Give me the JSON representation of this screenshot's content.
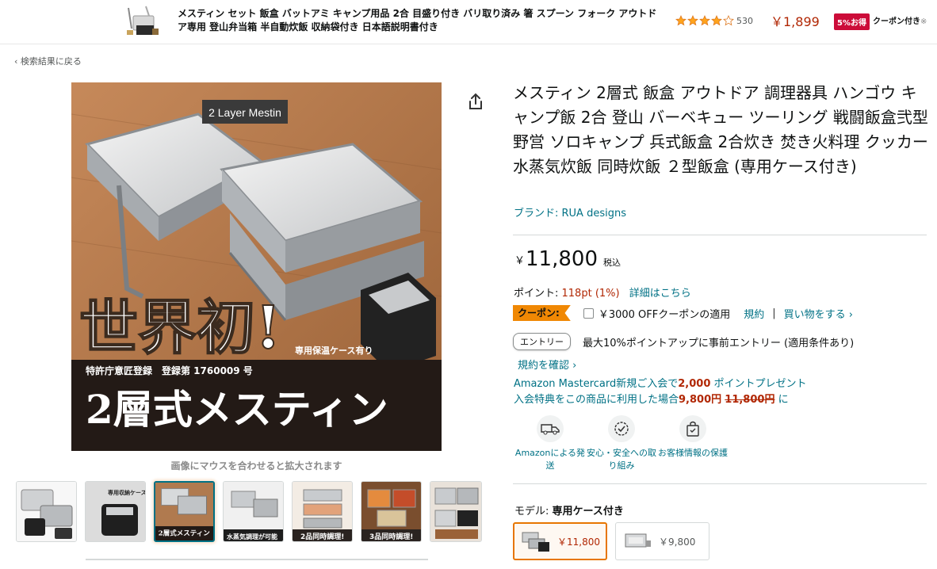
{
  "ad": {
    "title": "メスティン セット 飯盒 バットアミ キャンプ用品 2合 目盛り付き バリ取り済み 箸 スプーン フォーク アウトドア専用 登山弁当箱 半自動炊飯 収納袋付き 日本語説明書付き",
    "rating": 4.0,
    "review_count": "530",
    "price": "￥1,899",
    "discount_badge": "5%お得",
    "coupon_label": "クーポン付き",
    "coupon_note": "※"
  },
  "back_link": "‹ 検索結果に戻る",
  "main_image": {
    "top_label": "2 Layer Mestin",
    "headline": "世界初!",
    "case_note": "専用保温ケース有り",
    "patent": "特許庁意匠登録　登録第 1760009 号",
    "product_name": "2層式メスティン"
  },
  "hover_hint": "画像にマウスを合わせると拡大されます",
  "thumbnails": [
    {
      "caption": ""
    },
    {
      "caption": "専用収納ケース"
    },
    {
      "caption": "2層式メスティン"
    },
    {
      "caption": "水蒸気調理が可能"
    },
    {
      "caption": "2品同時調理!"
    },
    {
      "caption": "3品同時調理!"
    },
    {
      "caption": ""
    }
  ],
  "product": {
    "title": "メスティン 2層式 飯盒 アウトドア 調理器具 ハンゴウ キャンプ飯 2合 登山 バーベキュー ツーリング 戦闘飯盒弐型 野営 ソロキャンプ 兵式飯盒 2合炊き 焚き火料理 クッカー 水蒸気炊飯 同時炊飯 ２型飯盒 (専用ケース付き)",
    "brand": "ブランド: RUA designs"
  },
  "price": {
    "symbol": "￥",
    "value": "11,800",
    "tax": "税込"
  },
  "points": {
    "label": "ポイント: ",
    "value": "118pt",
    "percent": "(1%)",
    "link": "詳細はこちら"
  },
  "coupon": {
    "tag": "クーポン:",
    "text": "￥3000 OFFクーポンの適用",
    "terms": "規約",
    "separator": "|",
    "shop": "買い物をする ›"
  },
  "entry": {
    "button": "エントリー",
    "text": "最大10%ポイントアップに事前エントリー (適用条件あり)",
    "terms_link": "規約を確認 ›"
  },
  "card_promo": {
    "line1_a": "Amazon Mastercard新規ご入会で",
    "line1_b": "2,000",
    "line1_c": " ポイントプレゼント",
    "line2_a": "入会特典をこの商品に利用した場合",
    "line2_b": "9,800円",
    "line2_c": "11,800円",
    "line2_d": " に"
  },
  "badges": [
    {
      "icon": "delivery-van-icon",
      "label": "Amazonによる発送"
    },
    {
      "icon": "safety-shield-icon",
      "label": "安心・安全への取り組み"
    },
    {
      "icon": "secure-bag-icon",
      "label": "お客様情報の保護"
    }
  ],
  "model": {
    "label": "モデル: ",
    "selected": "専用ケース付き"
  },
  "variants": [
    {
      "price": "￥11,800"
    },
    {
      "price": "￥9,800"
    }
  ],
  "colors": {
    "link": "#007185",
    "price_red": "#b12704",
    "coupon_orange": "#f08804",
    "badge_red": "#cc0c39",
    "star": "#ffa41c"
  }
}
